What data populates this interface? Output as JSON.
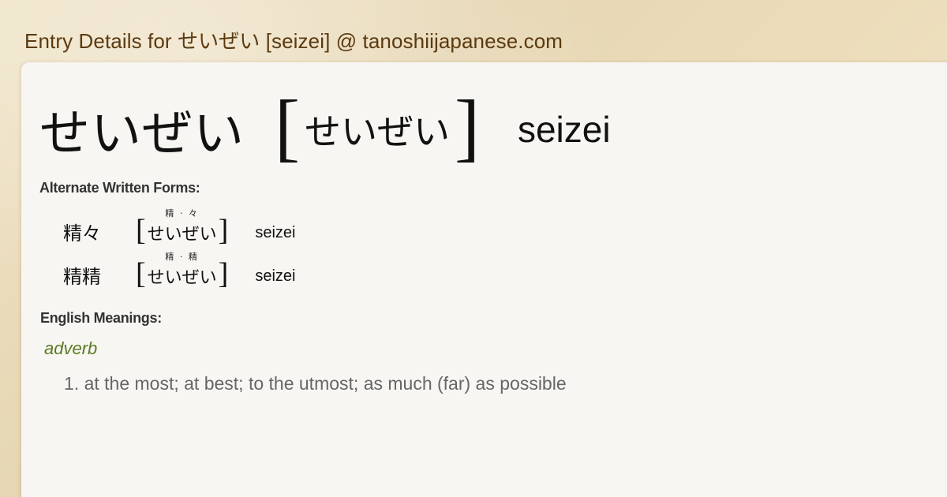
{
  "page": {
    "title": "Entry Details for せいぜい [seizei] @ tanoshiijapanese.com"
  },
  "entry": {
    "kana": "せいぜい",
    "bracket_open": "[",
    "reading": "せいぜい",
    "bracket_close": "]",
    "romaji": "seizei"
  },
  "alternate_forms": {
    "label": "Alternate Written Forms:",
    "items": [
      {
        "kanji": "精々",
        "furigana": "精 · 々",
        "reading": "せいぜい",
        "romaji": "seizei"
      },
      {
        "kanji": "精精",
        "furigana": "精 · 精",
        "reading": "せいぜい",
        "romaji": "seizei"
      }
    ]
  },
  "meanings": {
    "label": "English Meanings:",
    "part_of_speech": "adverb",
    "items": [
      {
        "text": "1. at the most; at best; to the utmost; as much (far) as possible"
      }
    ]
  },
  "colors": {
    "title": "#5c3a10",
    "part_of_speech": "#5a7a22",
    "meaning_text": "#666666",
    "panel": "#f7f6f2"
  }
}
